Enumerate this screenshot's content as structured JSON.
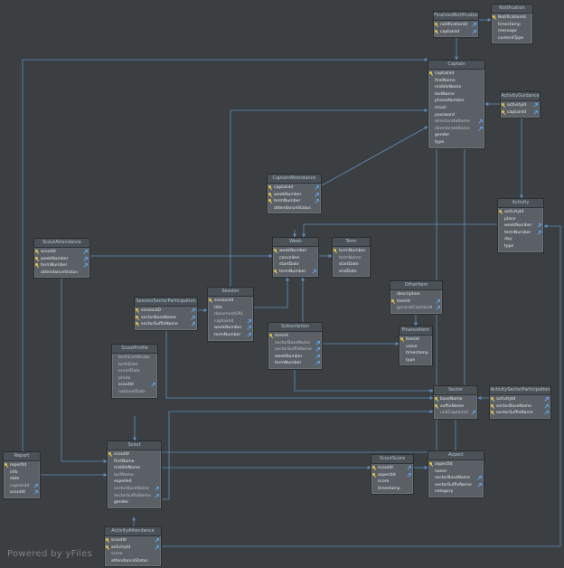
{
  "watermark": "Powered by yFiles",
  "colors": {
    "background": "#3c3f41",
    "entity": "#5a6066",
    "header": "#4a5157",
    "edge": "#5c8dc0",
    "key": "#e2c04a",
    "foreign_key": "#5aa0e6"
  },
  "entities": [
    {
      "id": "FinalizedNotification",
      "title": "FinalizedNotification",
      "fields": [
        {
          "name": "notificationId",
          "pk": true,
          "fk": true
        },
        {
          "name": "captainId",
          "pk": true,
          "fk": true
        }
      ]
    },
    {
      "id": "Notification",
      "title": "Notification",
      "fields": [
        {
          "name": "NotificationId",
          "pk": true
        },
        {
          "name": "timestamp"
        },
        {
          "name": "message"
        },
        {
          "name": "contentType"
        }
      ]
    },
    {
      "id": "Captain",
      "title": "Captain",
      "fields": [
        {
          "name": "captainId",
          "pk": true
        },
        {
          "name": "firstName"
        },
        {
          "name": "middleName"
        },
        {
          "name": "lastName"
        },
        {
          "name": "phoneNumber"
        },
        {
          "name": "email"
        },
        {
          "name": "password"
        },
        {
          "name": "directorateName",
          "nullable": true,
          "fk": true
        },
        {
          "name": "directorateName",
          "nullable": true,
          "fk": true
        },
        {
          "name": "gender"
        },
        {
          "name": "type"
        }
      ]
    },
    {
      "id": "ActivityGuidance",
      "title": "ActivityGuidance",
      "fields": [
        {
          "name": "activityId",
          "pk": true,
          "fk": true
        },
        {
          "name": "captainId",
          "pk": true,
          "fk": true
        }
      ]
    },
    {
      "id": "CaptainAttendance",
      "title": "CaptainAttendance",
      "fields": [
        {
          "name": "captainId",
          "pk": true,
          "fk": true
        },
        {
          "name": "weekNumber",
          "pk": true,
          "fk": true
        },
        {
          "name": "termNumber",
          "pk": true,
          "fk": true
        },
        {
          "name": "attendanceStatus"
        }
      ]
    },
    {
      "id": "Activity",
      "title": "Activity",
      "fields": [
        {
          "name": "activityId",
          "pk": true
        },
        {
          "name": "place"
        },
        {
          "name": "weekNumber",
          "fk": true
        },
        {
          "name": "termNumber",
          "fk": true
        },
        {
          "name": "day"
        },
        {
          "name": "type"
        }
      ]
    },
    {
      "id": "ScoutAttendance",
      "title": "ScoutAttendance",
      "fields": [
        {
          "name": "scoutId",
          "pk": true,
          "fk": true
        },
        {
          "name": "weekNumber",
          "pk": true,
          "fk": true
        },
        {
          "name": "termNumber",
          "pk": true,
          "fk": true
        },
        {
          "name": "attendanceStatus"
        }
      ]
    },
    {
      "id": "Week",
      "title": "Week",
      "fields": [
        {
          "name": "weekNumber",
          "pk": true
        },
        {
          "name": "cancelled"
        },
        {
          "name": "startDate"
        },
        {
          "name": "termNumber",
          "pk": true,
          "fk": true
        }
      ]
    },
    {
      "id": "Term",
      "title": "Term",
      "fields": [
        {
          "name": "termNumber",
          "pk": true
        },
        {
          "name": "termName",
          "nullable": true
        },
        {
          "name": "startDate"
        },
        {
          "name": "endDate"
        }
      ]
    },
    {
      "id": "Otherltem",
      "title": "Otherltem",
      "fields": [
        {
          "name": "description"
        },
        {
          "name": "itemId",
          "pk": true,
          "fk": true
        },
        {
          "name": "generalCaptainId",
          "nullable": true,
          "fk": true
        }
      ]
    },
    {
      "id": "SessionSectorParticipation",
      "title": "SessionSectorParticipation",
      "fields": [
        {
          "name": "sessionID",
          "pk": true,
          "fk": true
        },
        {
          "name": "sectorBaseName",
          "pk": true,
          "fk": true
        },
        {
          "name": "sectorSuffixName",
          "pk": true,
          "fk": true
        }
      ]
    },
    {
      "id": "Session",
      "title": "Session",
      "fields": [
        {
          "name": "sessionId",
          "pk": true
        },
        {
          "name": "title"
        },
        {
          "name": "documentURL",
          "nullable": true
        },
        {
          "name": "captainId",
          "nullable": true,
          "fk": true
        },
        {
          "name": "weekNumber",
          "fk": true
        },
        {
          "name": "termNumber",
          "fk": true
        }
      ]
    },
    {
      "id": "Subscription",
      "title": "Subscription",
      "fields": [
        {
          "name": "itemId",
          "pk": true
        },
        {
          "name": "sectorBaseName",
          "nullable": true,
          "fk": true
        },
        {
          "name": "sectorSuffixName",
          "nullable": true,
          "fk": true
        },
        {
          "name": "weekNumber",
          "fk": true
        },
        {
          "name": "termNumber",
          "fk": true
        }
      ]
    },
    {
      "id": "FinanceItem",
      "title": "FinanceItem",
      "fields": [
        {
          "name": "itemId",
          "pk": true
        },
        {
          "name": "value"
        },
        {
          "name": "timestamp"
        },
        {
          "name": "type"
        }
      ]
    },
    {
      "id": "ScoutProfile",
      "title": "ScoutProfile",
      "fields": [
        {
          "name": "birthCertificate",
          "nullable": true
        },
        {
          "name": "birthDate",
          "nullable": true
        },
        {
          "name": "enrollDate",
          "nullable": true
        },
        {
          "name": "photo",
          "nullable": true
        },
        {
          "name": "scoutId",
          "fk": true
        },
        {
          "name": "nationalDate",
          "nullable": true
        }
      ]
    },
    {
      "id": "Sector",
      "title": "Sector",
      "fields": [
        {
          "name": "baseName",
          "pk": true
        },
        {
          "name": "suffixName",
          "pk": true
        },
        {
          "name": "unitCaptainId",
          "nullable": true,
          "fk": true
        }
      ]
    },
    {
      "id": "ActivitySectorParticipation",
      "title": "ActivitySectorParticipation",
      "fields": [
        {
          "name": "activityId",
          "pk": true,
          "fk": true
        },
        {
          "name": "sectorBaseName",
          "pk": true,
          "fk": true
        },
        {
          "name": "sectorSuffixName",
          "pk": true,
          "fk": true
        }
      ]
    },
    {
      "id": "Report",
      "title": "Report",
      "fields": [
        {
          "name": "reportId",
          "pk": true
        },
        {
          "name": "info"
        },
        {
          "name": "date"
        },
        {
          "name": "captainId",
          "nullable": true,
          "fk": true
        },
        {
          "name": "scoutId",
          "fk": true
        }
      ]
    },
    {
      "id": "Scout",
      "title": "Scout",
      "fields": [
        {
          "name": "scoutId",
          "pk": true
        },
        {
          "name": "firstName"
        },
        {
          "name": "middleName"
        },
        {
          "name": "lastName",
          "nullable": true
        },
        {
          "name": "expelled"
        },
        {
          "name": "sectorBaseName",
          "nullable": true,
          "fk": true
        },
        {
          "name": "sectorSuffixName",
          "nullable": true,
          "fk": true
        },
        {
          "name": "gender"
        }
      ]
    },
    {
      "id": "ScoutScore",
      "title": "ScoutScore",
      "fields": [
        {
          "name": "scoutId",
          "pk": true,
          "fk": true
        },
        {
          "name": "aspectId",
          "pk": true,
          "fk": true
        },
        {
          "name": "score"
        },
        {
          "name": "timestamp"
        }
      ]
    },
    {
      "id": "Aspect",
      "title": "Aspect",
      "fields": [
        {
          "name": "aspectId",
          "pk": true
        },
        {
          "name": "name"
        },
        {
          "name": "sectorBaseName",
          "fk": true
        },
        {
          "name": "sectorSuffixName",
          "fk": true
        },
        {
          "name": "category"
        }
      ]
    },
    {
      "id": "ActivityAttendance",
      "title": "ActivityAttendance",
      "fields": [
        {
          "name": "scoutId",
          "pk": true,
          "fk": true
        },
        {
          "name": "activityId",
          "pk": true,
          "fk": true
        },
        {
          "name": "score",
          "nullable": true
        },
        {
          "name": "attendanceStatus"
        }
      ]
    }
  ]
}
